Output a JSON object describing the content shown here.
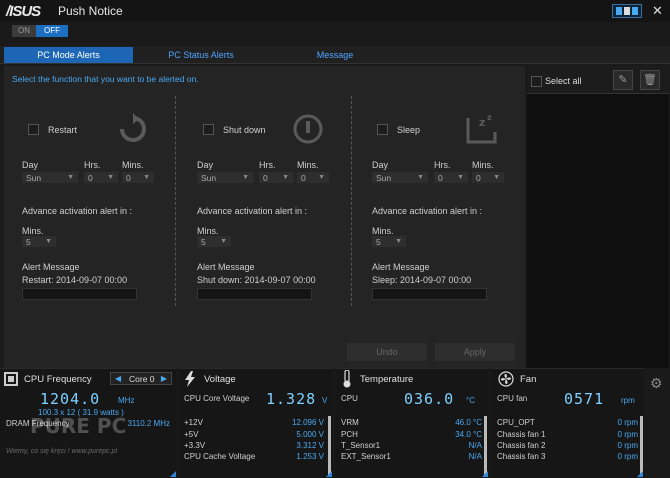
{
  "app": {
    "logo": "/ISUS",
    "title": "Push Notice",
    "close": "✕"
  },
  "toggle": {
    "on_label": "ON",
    "off_label": "OFF"
  },
  "tabs": [
    "PC Mode Alerts",
    "PC Status Alerts",
    "Message"
  ],
  "instruction": "Select the function that you want to be alerted on.",
  "labels": {
    "day": "Day",
    "hrs": "Hrs.",
    "mins": "Mins.",
    "advance": "Advance activation alert in :",
    "mins2": "Mins.",
    "alert_message": "Alert Message"
  },
  "modes": [
    {
      "name": "Restart",
      "day": "Sun",
      "hrs": "0",
      "mins": "0",
      "advance": "5",
      "message": "Restart: 2014-09-07 00:00",
      "icon": "restart-icon"
    },
    {
      "name": "Shut down",
      "day": "Sun",
      "hrs": "0",
      "mins": "0",
      "advance": "5",
      "message": "Shut down: 2014-09-07 00:00",
      "icon": "power-icon"
    },
    {
      "name": "Sleep",
      "day": "Sun",
      "hrs": "0",
      "mins": "0",
      "advance": "5",
      "message": "Sleep: 2014-09-07 00:00",
      "icon": "sleep-icon"
    }
  ],
  "buttons": {
    "undo": "Undo",
    "apply": "Apply"
  },
  "right_panel": {
    "select_all": "Select all"
  },
  "cpu_freq": {
    "title": "CPU Frequency",
    "core_select": "Core 0",
    "value": "1204.0",
    "unit": "MHz",
    "detail": "100.3  x  12  ( 31.9    watts )",
    "dram_label": "DRAM Frequency",
    "dram_value": "3110.2  MHz"
  },
  "voltage": {
    "title": "Voltage",
    "main_label": "CPU Core Voltage",
    "main_value": "1.328",
    "main_unit": "V",
    "rows": [
      {
        "label": "+12V",
        "value": "12.096  V"
      },
      {
        "label": "+5V",
        "value": "5.000  V"
      },
      {
        "label": "+3.3V",
        "value": "3.312  V"
      },
      {
        "label": "CPU Cache Voltage",
        "value": "1.253  V"
      }
    ]
  },
  "temperature": {
    "title": "Temperature",
    "main_label": "CPU",
    "main_value": "036.0",
    "main_unit": "°C",
    "rows": [
      {
        "label": "VRM",
        "value": "46.0 °C"
      },
      {
        "label": "PCH",
        "value": "34.0 °C"
      },
      {
        "label": "T_Sensor1",
        "value": "N/A"
      },
      {
        "label": "EXT_Sensor1",
        "value": "N/A"
      }
    ]
  },
  "fan": {
    "title": "Fan",
    "main_label": "CPU fan",
    "main_value": "0571",
    "main_unit": "rpm",
    "rows": [
      {
        "label": "CPU_OPT",
        "value": "0   rpm"
      },
      {
        "label": "Chassis fan 1",
        "value": "0   rpm"
      },
      {
        "label": "Chassis fan 2",
        "value": "0   rpm"
      },
      {
        "label": "Chassis fan 3",
        "value": "0   rpm"
      }
    ]
  },
  "watermark": {
    "brand": "PURE PC",
    "tagline": "Wiemy, co się kręci ! www.purepc.pl"
  },
  "colors": {
    "accent": "#1c66b5",
    "value_blue": "#4aa8f0",
    "bg": "#1a1a1a"
  }
}
